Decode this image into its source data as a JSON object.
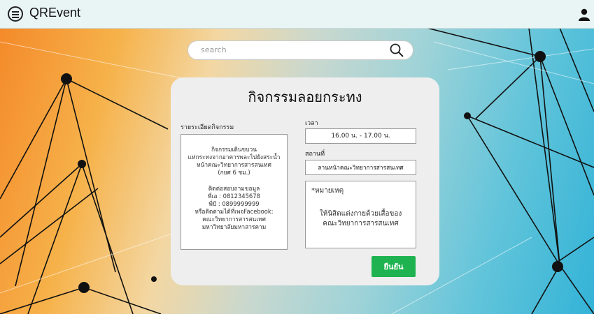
{
  "header": {
    "title": "QREvent",
    "menu_icon": "hamburger-menu-icon",
    "user_icon": "user-icon"
  },
  "search": {
    "placeholder": "search",
    "icon": "search-icon"
  },
  "card": {
    "title": "กิจกรรมลอยกระทง",
    "details_label": "รายระเอียดกิจกรรม",
    "details_body": "กิจกรรมเดินขบวน\nแห่กระทงจากอาคารพละไปยังสระน้ำ\nหน้าคณะวิทยาการสารสนเทศ\n(กยศ 6 ชม.)",
    "contact_body": "ติดต่อสอบถามขอมูล\nพี่เอ : 0812345678\nพี่บี : 0899999999\nหรือติดตามได้ที่เพจFacebook:\nคณะวิทยาการสารสนเทศ\nมหาวิทยาลัยมหาสารคาม",
    "time_label": "เวลา",
    "time_value": "16.00 น. - 17.00 น.",
    "place_label": "สถานที่",
    "place_value": "ลานหน้าคณะวิทยาการสารสนเทศ",
    "note_label": "*หมายเหตุ",
    "note_text": "ให้นิสิตแต่งกายด้วยเสื้อของ\nคณะวิทยาการสารสนเทศ",
    "confirm_label": "ยืนยัน"
  },
  "colors": {
    "confirm_button": "#1eb350",
    "topbar": "#e9f4f5",
    "card": "#eeeeee"
  }
}
